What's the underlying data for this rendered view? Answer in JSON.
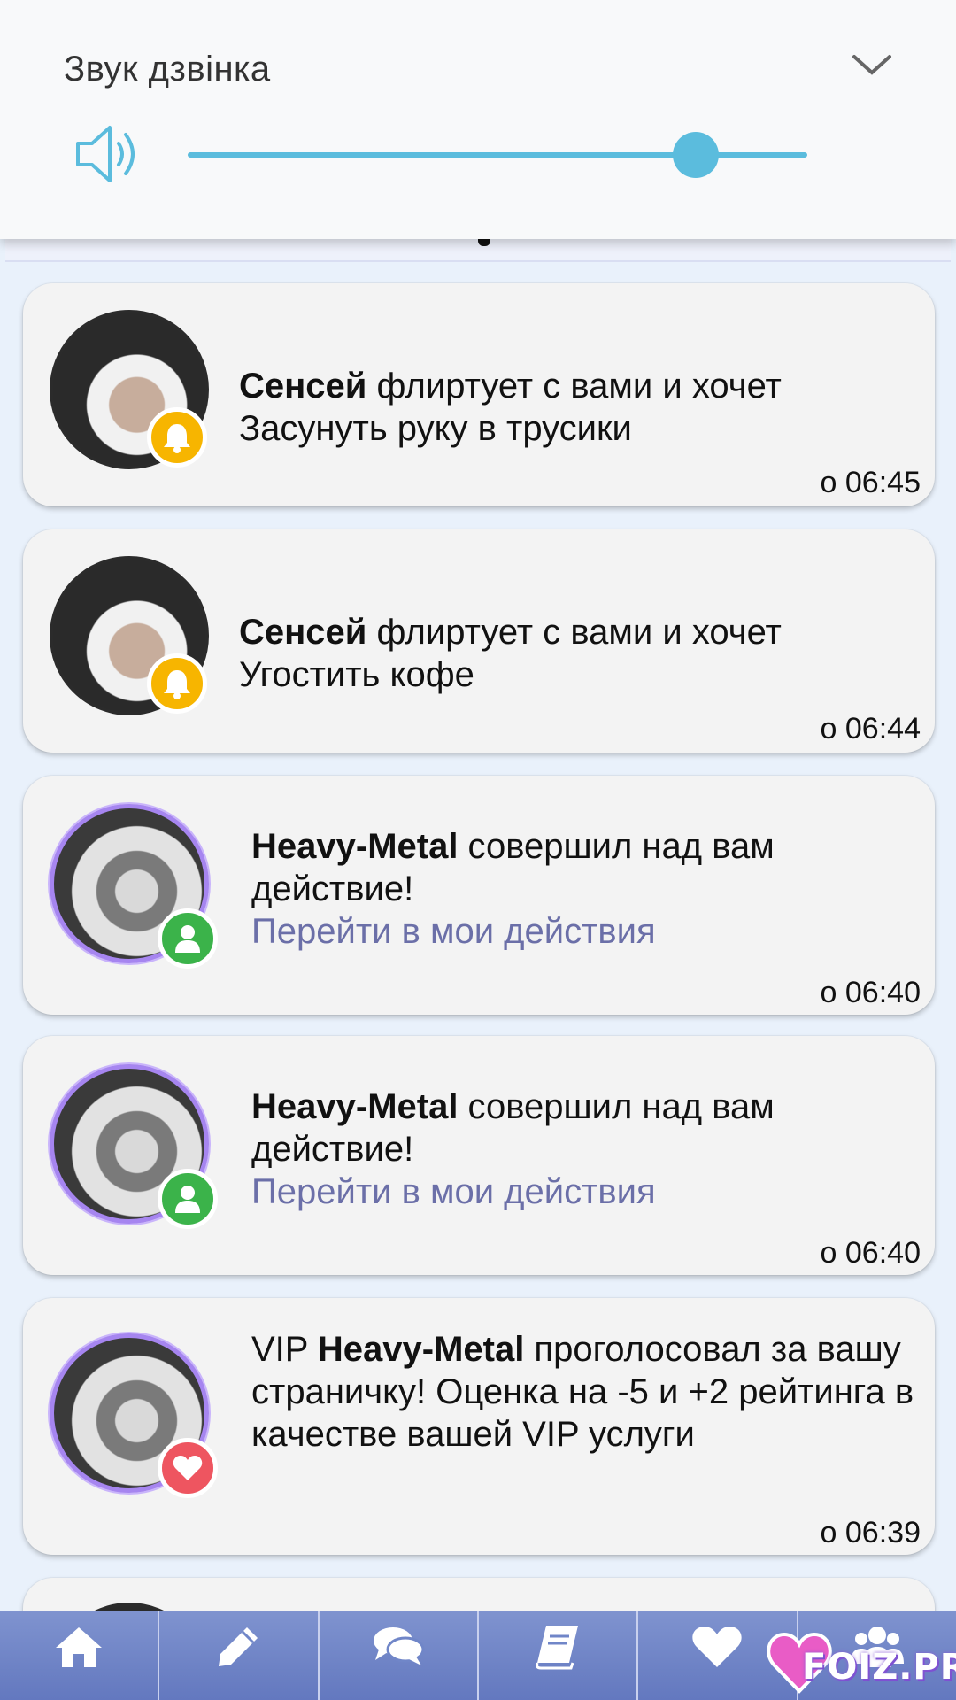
{
  "volume": {
    "title": "Звук дзвінка",
    "level_fraction": 0.82
  },
  "notifications": [
    {
      "avatar": "user-photo-sensei",
      "badge": "bell-icon",
      "name": "Сенсей",
      "text": " флиртует с вами и хочет Засунуть руку в трусики",
      "link": "",
      "prefix": "",
      "time": "о 06:45"
    },
    {
      "avatar": "user-photo-sensei",
      "badge": "bell-icon",
      "name": "Сенсей",
      "text": " флиртует с вами и хочет Угостить кофе",
      "link": "",
      "prefix": "",
      "time": "о 06:44"
    },
    {
      "avatar": "user-photo-heavy-metal",
      "badge": "user-icon",
      "name": "Heavy-Metal",
      "text": " совершил над вам действие!",
      "link": "Перейти в мои действия",
      "prefix": "",
      "time": "о 06:40"
    },
    {
      "avatar": "user-photo-heavy-metal",
      "badge": "user-icon",
      "name": "Heavy-Metal",
      "text": " совершил над вам действие!",
      "link": "Перейти в мои действия",
      "prefix": "",
      "time": "о 06:40"
    },
    {
      "avatar": "user-photo-heavy-metal",
      "badge": "heart-icon",
      "name": "Heavy-Metal",
      "text": " проголосовал за вашу страничку! Оценка на -5 и +2 рейтинга в качестве вашей VIP услуги",
      "link": "",
      "prefix": "VIP ",
      "time": "о 06:39"
    }
  ],
  "bottom_nav": [
    {
      "icon": "home-icon"
    },
    {
      "icon": "pencil-icon"
    },
    {
      "icon": "chat-icon"
    },
    {
      "icon": "book-icon"
    },
    {
      "icon": "heart-icon"
    },
    {
      "icon": "users-icon"
    }
  ],
  "watermark": {
    "text": "FOIZ.PRO"
  },
  "colors": {
    "accent": "#5bbcdd",
    "link": "#6b6fa8",
    "nav": "#7086c8",
    "bell_badge": "#f7b500",
    "user_badge": "#3bb34a",
    "heart_badge": "#ee5560",
    "avatar_ring": "#a685f0"
  }
}
